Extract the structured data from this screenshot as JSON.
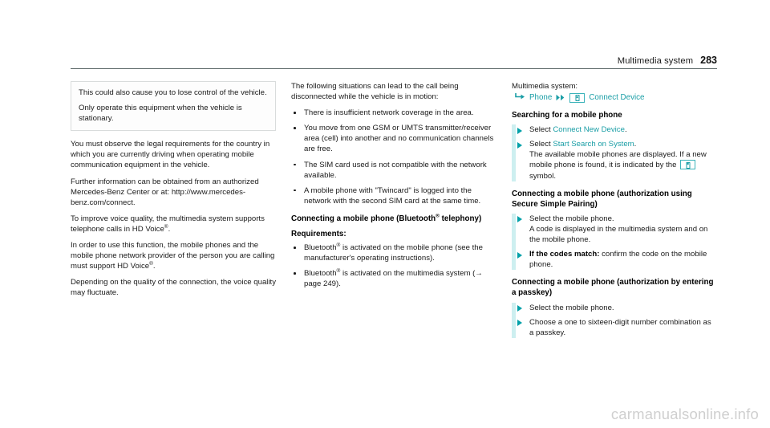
{
  "header": {
    "title": "Multimedia system",
    "page_number": "283"
  },
  "column1": {
    "notebox": {
      "paragraphs": [
        "This could also cause you to lose control of the vehicle.",
        "Only operate this equipment when the vehicle is stationary."
      ]
    },
    "paragraphs": [
      "You must observe the legal requirements for the country in which you are currently driving when operating mobile communication equipment in the vehicle.",
      "Further information can be obtained from an authorized Mercedes-Benz Center or at: http://www.mercedes-benz.com/connect.",
      "To improve voice quality, the multimedia system supports telephone calls in HD Voice",
      "In order to use this function, the mobile phones and the mobile phone network provider of the person you are calling must support HD Voice",
      "Depending on the quality of the connection, the voice quality may fluctuate."
    ]
  },
  "column2": {
    "intro": "The following situations can lead to the call being disconnected while the vehicle is in motion:",
    "situations": [
      "There is insufficient network coverage in the area.",
      "You move from one GSM or UMTS transmitter/receiver area (cell) into another and no communication channels are free.",
      "The SIM card used is not compatible with the network available.",
      "A mobile phone with \"Twincard\" is logged into the network with the second SIM card at the same time."
    ],
    "heading_pre": "Connecting a mobile phone (Bluetooth",
    "heading_post": " telephony)",
    "requirements_label": "Requirements:",
    "requirements": [
      {
        "pre": "Bluetooth",
        "post": " is activated on the mobile phone (see the manufacturer's operating instructions)."
      },
      {
        "pre": "Bluetooth",
        "post": " is activated on the multimedia system (→ page 249)."
      }
    ]
  },
  "column3": {
    "crumb_intro": "Multimedia system:",
    "crumb": {
      "enter_icon": "enter-arrow-icon",
      "first_label": "Phone",
      "separator_icon": "double-chevron-right-icon",
      "device_icon": "connect-device-icon",
      "second_label": "Connect Device"
    },
    "section1": {
      "heading": "Searching for a mobile phone",
      "steps": [
        {
          "pre": "Select ",
          "term": "Connect New Device",
          "post": "."
        },
        {
          "pre": "Select ",
          "term": "Start Search on System",
          "post": ".",
          "sub_before": "The available mobile phones are displayed. If a new mobile phone is found, it is indicated by the ",
          "sub_icon": "connect-device-icon",
          "sub_after": " symbol."
        }
      ]
    },
    "section2": {
      "heading": "Connecting a mobile phone (authorization using Secure Simple Pairing)",
      "steps": [
        {
          "pre": "Select the mobile phone.",
          "sub_before": "A code is displayed in the multimedia system and on the mobile phone."
        },
        {
          "bold": "If the codes match:",
          "post": " confirm the code on the mobile phone."
        }
      ]
    },
    "section3": {
      "heading": "Connecting a mobile phone (authorization by entering a passkey)",
      "steps": [
        {
          "pre": "Select the mobile phone."
        },
        {
          "pre": "Choose a one to sixteen-digit number combination as a passkey."
        }
      ]
    }
  },
  "watermark": "carmanualsonline.info",
  "colors": {
    "teal_term": "#1a9ea6",
    "teal_marker": "#00a0a8",
    "rail": "#cdeff0",
    "header_rule": "#5f6b6b",
    "watermark": "#cfcfcf"
  }
}
